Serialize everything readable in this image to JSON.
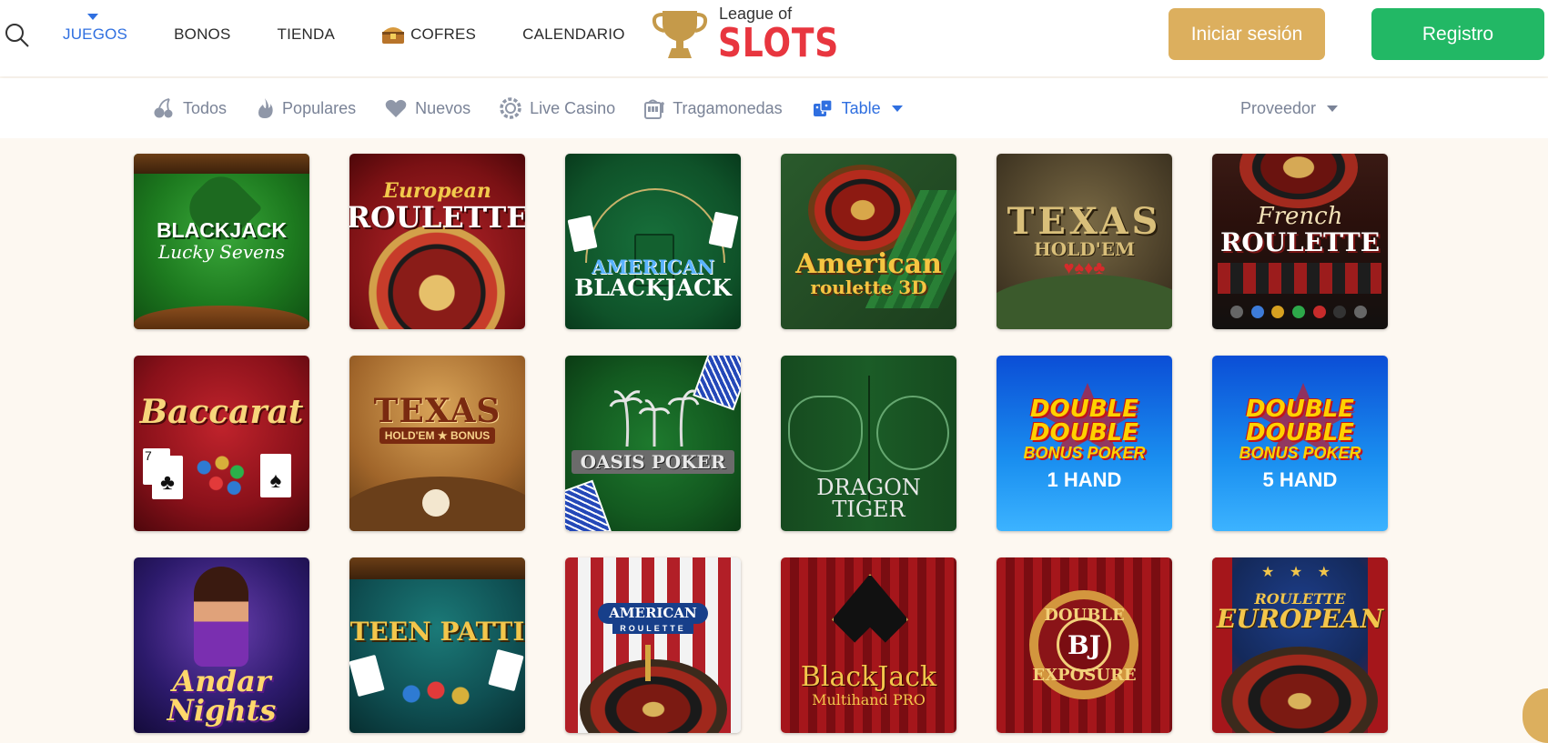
{
  "header": {
    "nav": [
      {
        "label": "JUEGOS",
        "active": true
      },
      {
        "label": "BONOS",
        "active": false
      },
      {
        "label": "TIENDA",
        "active": false
      },
      {
        "label": "COFRES",
        "active": false,
        "icon": "chest-icon"
      },
      {
        "label": "CALENDARIO",
        "active": false
      }
    ],
    "logo": {
      "small": "League of",
      "big": "SLOTS"
    },
    "login_label": "Iniciar sesión",
    "register_label": "Registro"
  },
  "filters": {
    "categories": [
      {
        "label": "Todos",
        "icon": "cherries-icon"
      },
      {
        "label": "Populares",
        "icon": "flame-icon"
      },
      {
        "label": "Nuevos",
        "icon": "heart-icon"
      },
      {
        "label": "Live Casino",
        "icon": "chip-icon"
      },
      {
        "label": "Tragamonedas",
        "icon": "slot-machine-icon"
      },
      {
        "label": "Table",
        "icon": "dice-icon",
        "active": true
      }
    ],
    "provider_label": "Proveedor"
  },
  "colors": {
    "accent_blue": "#2f6fe0",
    "login_gold": "#dcaf5e",
    "register_green": "#22b865",
    "logo_red": "#e8363f",
    "page_bg": "#fdf8f1"
  },
  "games": [
    {
      "line1": "BLACKJACK",
      "line2": "Lucky Sevens"
    },
    {
      "line1": "European",
      "line2": "ROULETTE"
    },
    {
      "line1": "AMERICAN",
      "line2": "BLACKJACK"
    },
    {
      "line1": "American",
      "line2": "roulette 3D"
    },
    {
      "line1": "TEXAS",
      "line2": "HOLD'EM"
    },
    {
      "line1": "French",
      "line2": "ROULETTE"
    },
    {
      "line1": "Baccarat",
      "line2": ""
    },
    {
      "line1": "TEXAS",
      "line2": "HOLD'EM ★ BONUS"
    },
    {
      "line1": "OASIS POKER",
      "line2": ""
    },
    {
      "line1": "DRAGON",
      "line2": "TIGER"
    },
    {
      "line1": "DOUBLE DOUBLE",
      "line2": "BONUS POKER",
      "line3": "1 HAND"
    },
    {
      "line1": "DOUBLE DOUBLE",
      "line2": "BONUS POKER",
      "line3": "5 HAND"
    },
    {
      "line1": "Andar",
      "line2": "Nights"
    },
    {
      "line1": "TEEN PATTI",
      "line2": ""
    },
    {
      "line1": "AMERICAN",
      "line2": "ROULETTE"
    },
    {
      "line1": "BlackJack",
      "line2": "Multihand PRO"
    },
    {
      "line1": "DOUBLE",
      "line2": "BJ",
      "line3": "EXPOSURE"
    },
    {
      "line1": "ROULETTE",
      "line2": "EUROPEAN"
    }
  ]
}
